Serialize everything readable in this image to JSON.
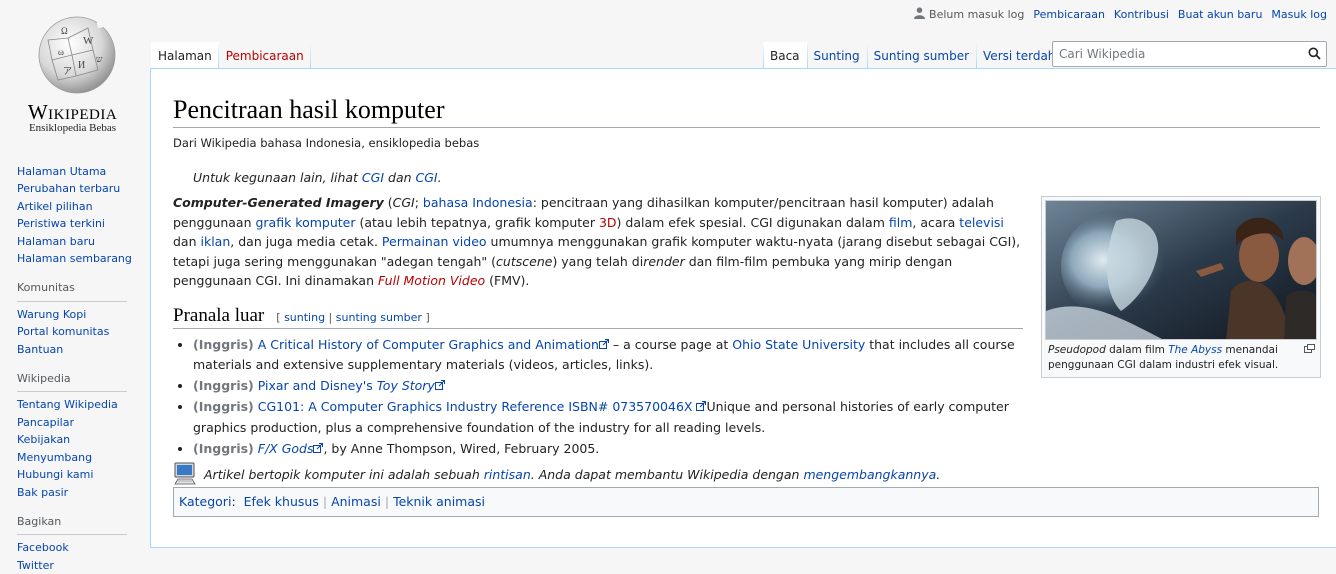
{
  "logo": {
    "wordmark": "Wikipedia",
    "tagline": "Ensiklopedia Bebas"
  },
  "personal": {
    "not_logged_in": "Belum masuk log",
    "links": [
      "Pembicaraan",
      "Kontribusi",
      "Buat akun baru",
      "Masuk log"
    ]
  },
  "tabs": {
    "left": [
      "Halaman",
      "Pembicaraan"
    ],
    "right": [
      "Baca",
      "Sunting",
      "Sunting sumber",
      "Versi terdahulu"
    ]
  },
  "search": {
    "placeholder": "Cari Wikipedia"
  },
  "sidebar": {
    "nav": [
      "Halaman Utama",
      "Perubahan terbaru",
      "Artikel pilihan",
      "Peristiwa terkini",
      "Halaman baru",
      "Halaman sembarang"
    ],
    "komunitas_heading": "Komunitas",
    "komunitas": [
      "Warung Kopi",
      "Portal komunitas",
      "Bantuan"
    ],
    "wikipedia_heading": "Wikipedia",
    "wikipedia": [
      "Tentang Wikipedia",
      "Pancapilar",
      "Kebijakan",
      "Menyumbang",
      "Hubungi kami",
      "Bak pasir"
    ],
    "bagikan_heading": "Bagikan",
    "bagikan": [
      "Facebook",
      "Twitter"
    ]
  },
  "article": {
    "title": "Pencitraan hasil komputer",
    "site_sub": "Dari Wikipedia bahasa Indonesia, ensiklopedia bebas",
    "hatnote": {
      "prefix": "Untuk kegunaan lain, lihat ",
      "link1": "CGI",
      "mid": " dan ",
      "link2": "CGI",
      "suffix": "."
    },
    "lead": {
      "term": "Computer-Generated Imagery",
      "p1": " (",
      "abbr": "CGI",
      "p2": "; ",
      "lang_link": "bahasa Indonesia",
      "p3": ": pencitraan yang dihasilkan komputer/pencitraan hasil komputer) adalah penggunaan ",
      "link_grafik": "grafik komputer",
      "p4": " (atau lebih tepatnya, grafik komputer ",
      "link_3d": "3D",
      "p5": ") dalam efek spesial. CGI digunakan dalam ",
      "link_film": "film",
      "p6": ", acara ",
      "link_tv": "televisi",
      "p7": " dan ",
      "link_iklan": "iklan",
      "p8": ", dan juga media cetak. ",
      "link_game": "Permainan video",
      "p9": " umumnya menggunakan grafik komputer waktu-nyata (jarang disebut sebagai CGI), tetapi juga sering menggunakan \"adegan tengah\" (",
      "cutscene": "cutscene",
      "p10": ") yang telah di",
      "render": "render",
      "p11": " dan film-film pembuka yang mirip dengan penggunaan CGI. Ini dinamakan ",
      "fmv": "Full Motion Video",
      "p12": " (FMV)."
    },
    "section": {
      "title": "Pranala luar",
      "edit1": "sunting",
      "edit2": "sunting sumber"
    },
    "extlinks": [
      {
        "lang": "(Inggris)",
        "link": "A Critical History of Computer Graphics and Animation",
        "mid": " – a course page at ",
        "link2": "Ohio State University",
        "rest": " that includes all course materials and extensive supplementary materials (videos, articles, links)."
      },
      {
        "lang": "(Inggris)",
        "link": "Pixar and Disney's ",
        "link_italic": "Toy Story",
        "rest": ""
      },
      {
        "lang": "(Inggris)",
        "link": "CG101: A Computer Graphics Industry Reference ISBN# 073570046X",
        "rest": "Unique and personal histories of early computer graphics production, plus a comprehensive foundation of the industry for all reading levels."
      },
      {
        "lang": "(Inggris)",
        "link_italic": "F/X Gods",
        "rest": ", by Anne Thompson, Wired, February 2005."
      }
    ],
    "stub": {
      "prefix": "Artikel bertopik komputer ini adalah sebuah ",
      "link1": "rintisan",
      "mid": ". Anda dapat membantu Wikipedia dengan ",
      "link2": "mengembangkannya",
      "suffix": "."
    },
    "thumb": {
      "cap_italic": "Pseudopod",
      "cap_mid": " dalam film ",
      "cap_link": "The Abyss",
      "cap_rest": " menandai penggunaan CGI dalam industri efek visual."
    },
    "categories": {
      "label": "Kategori",
      "items": [
        "Efek khusus",
        "Animasi",
        "Teknik animasi"
      ]
    }
  }
}
